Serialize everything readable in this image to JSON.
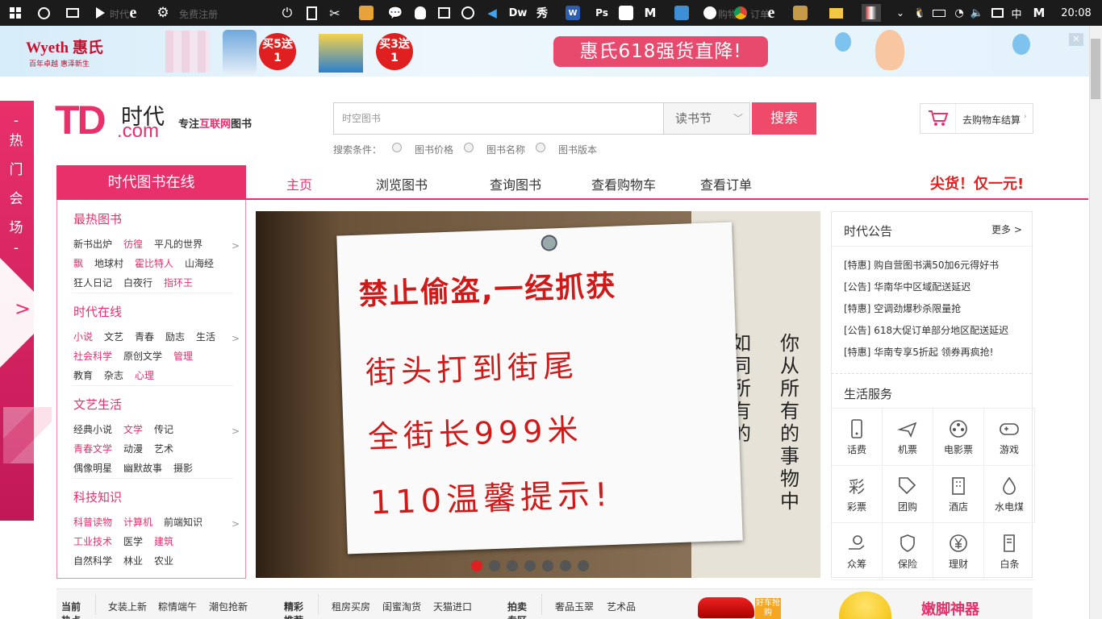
{
  "taskbar": {
    "ghost_text_1": "时代·",
    "ghost_text_2": "免费注册",
    "ghost_text_3": "购物",
    "ghost_text_4": "订单",
    "apps": [
      "ie-icon",
      "settings-icon",
      "power-icon",
      "calculator-icon",
      "scissors-icon",
      "app-icon",
      "wechat-icon",
      "qq-icon",
      "news-icon",
      "m-icon",
      "vscode-icon"
    ],
    "dw_label": "Dw",
    "xiu_label": "秀",
    "w_label": "W",
    "ps_label": "Ps",
    "m_label": "M",
    "ime_label": "中",
    "m2_label": "M",
    "clock": "20:08"
  },
  "ad": {
    "brand": "Wyeth 惠氏",
    "brand_slogan": "百年卓越 惠泽新生",
    "badge1": "买5送1",
    "badge2": "买3送1",
    "headline": "惠氏618强货直降!",
    "close": "✕"
  },
  "header": {
    "logo_td": "TD",
    "logo_cn": "时代",
    "logo_com": ".com",
    "slogan_pre": "专注",
    "slogan_hl": "互联网",
    "slogan_post": "图书",
    "search_placeholder": "时空图书",
    "search_select": "读书节",
    "search_button": "搜索",
    "conditions_label": "搜索条件：",
    "conditions": [
      "图书价格",
      "图书名称",
      "图书版本"
    ],
    "cart_label": "去购物车结算"
  },
  "nav": {
    "brand": "时代图书在线",
    "items": [
      "主页",
      "浏览图书",
      "查询图书",
      "查看购物车",
      "查看订单"
    ],
    "promo": "尖货！仅一元!"
  },
  "sidebar": {
    "categories": [
      {
        "title": "最热图书",
        "rows": [
          [
            "新书出炉",
            "彷徨",
            "平凡的世界"
          ],
          [
            "飘",
            "地球村",
            "霍比特人",
            "山海经"
          ],
          [
            "狂人日记",
            "白夜行",
            "指环王"
          ]
        ]
      },
      {
        "title": "时代在线",
        "rows": [
          [
            "小说",
            "文艺",
            "青春",
            "励志",
            "生活"
          ],
          [
            "社会科学",
            "原创文学",
            "管理"
          ],
          [
            "教育",
            "杂志",
            "心理"
          ]
        ]
      },
      {
        "title": "文艺生活",
        "rows": [
          [
            "经典小说",
            "文学",
            "传记"
          ],
          [
            "青春文学",
            "动漫",
            "艺术"
          ],
          [
            "偶像明星",
            "幽默故事",
            "摄影"
          ]
        ]
      },
      {
        "title": "科技知识",
        "rows": [
          [
            "科普读物",
            "计算机",
            "前端知识"
          ],
          [
            "工业技术",
            "医学",
            "建筑"
          ],
          [
            "自然科学",
            "林业",
            "农业"
          ]
        ]
      }
    ],
    "arrow": ">"
  },
  "promo_strip": {
    "chars": [
      "-",
      "热",
      "门",
      "会",
      "场",
      "-"
    ],
    "arrow": ">"
  },
  "slider": {
    "line1": "禁止偷盗,一经抓获",
    "line2": "街头打到街尾",
    "line3": "全街长999米",
    "line4": "110温馨提示!",
    "side_text": "你从所有的事物中",
    "side_text2": "如同所有的"
  },
  "notice": {
    "title": "时代公告",
    "more": "更多 >",
    "items": [
      {
        "tag": "[特惠]",
        "text": "购自营图书满50加6元得好书"
      },
      {
        "tag": "[公告]",
        "text": "华南华中区域配送延迟"
      },
      {
        "tag": "[特惠]",
        "text": "空调劲爆秒杀限量抢"
      },
      {
        "tag": "[公告]",
        "text": "618大促订单部分地区配送延迟"
      },
      {
        "tag": "[特惠]",
        "text": "华南专享5折起 领券再疯抢!"
      }
    ],
    "services_title": "生活服务",
    "services": [
      "话费",
      "机票",
      "电影票",
      "游戏",
      "彩票",
      "团购",
      "酒店",
      "水电煤",
      "众筹",
      "保险",
      "理财",
      "白条"
    ]
  },
  "bottom": {
    "group1_title": "当前热点",
    "group1": [
      "女装上新",
      "粽情端午",
      "潮包抢新"
    ],
    "group2_title": "精彩推荐",
    "group2": [
      "租房买房",
      "闺蜜淘货",
      "天猫进口"
    ],
    "group3_title": "拍卖专区",
    "group3": [
      "奢品玉翠",
      "艺术品"
    ],
    "car_tag": "好车抢购",
    "ad_text": "嫩脚神器"
  }
}
